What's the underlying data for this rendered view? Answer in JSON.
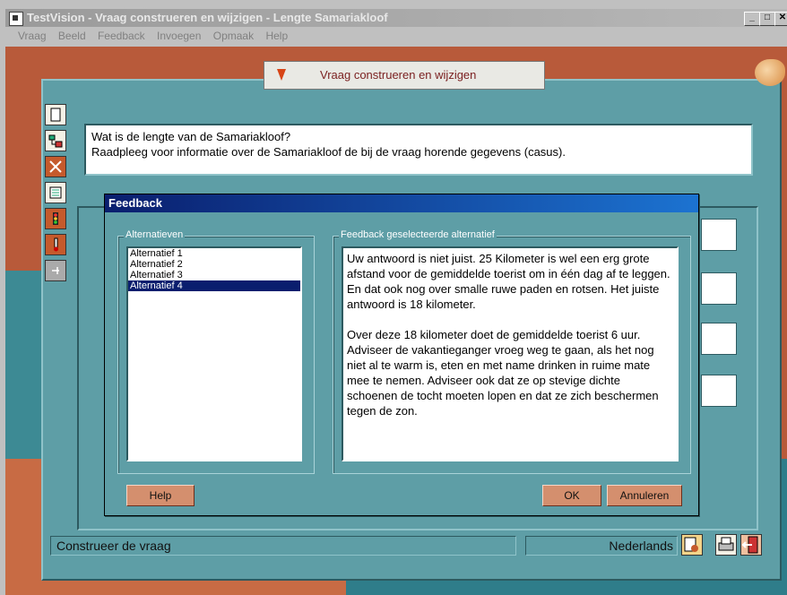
{
  "window": {
    "title": "TestVision - Vraag construeren en wijzigen - Lengte Samariakloof",
    "controls": [
      "_",
      "□",
      "✕"
    ]
  },
  "menu": [
    "Vraag",
    "Beeld",
    "Feedback",
    "Invoegen",
    "Opmaak",
    "Help"
  ],
  "top_tab": {
    "label": "Vraag construeren en wijzigen"
  },
  "question": {
    "line1": "Wat is de lengte van de Samariakloof?",
    "line2": "Raadpleeg voor informatie over de Samariakloof de bij de vraag horende gegevens (casus)."
  },
  "dialog": {
    "title": "Feedback",
    "alternatives_group": "Alternatieven",
    "alternatives": [
      "Alternatief 1",
      "Alternatief 2",
      "Alternatief 3",
      "Alternatief 4"
    ],
    "selected_index": 3,
    "feedback_group": "Feedback geselecteerde alternatief",
    "feedback_paragraph1": "Uw antwoord is niet juist. 25 Kilometer is wel een erg grote afstand voor de gemiddelde toerist om in één dag af te leggen. En dat ook nog over smalle ruwe paden en rotsen. Het juiste antwoord is 18 kilometer.",
    "feedback_paragraph2": "Over deze 18 kilometer doet de gemiddelde toerist 6 uur. Adviseer de vakantieganger vroeg weg te gaan, als het nog niet al te warm is, eten en met name drinken in ruime mate mee te nemen. Adviseer ook dat ze op stevige dichte schoenen de tocht moeten lopen en dat ze zich beschermen tegen de zon.",
    "help_label": "Help",
    "ok_label": "OK",
    "cancel_label": "Annuleren"
  },
  "status": {
    "left": "Construeer de vraag",
    "language": "Nederlands"
  },
  "colors": {
    "panel": "#5e9ea6",
    "title_active": "#0a1e6e",
    "button": "#d48f6e"
  }
}
